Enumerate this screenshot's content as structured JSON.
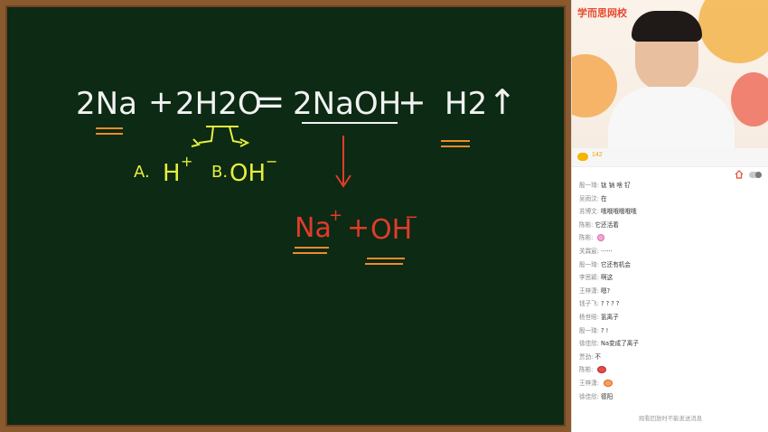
{
  "board": {
    "equation": {
      "reactant_na": "2Na",
      "plus1": "+",
      "reactant_water": "2H2O",
      "equals": "=",
      "product_naoh": "2NaOH",
      "plus2": "+",
      "product_h2": "H2",
      "arrow_up": "↑"
    },
    "options": {
      "a_label": "A.",
      "a_value": "H",
      "a_charge": "+",
      "b_label": "B.",
      "b_value": "OH",
      "b_charge": "−"
    },
    "ions": {
      "na": "Na",
      "na_charge": "+",
      "plus": "+",
      "oh": "OH",
      "oh_charge": "−"
    },
    "colors": {
      "chalk_white": "#f2f2f2",
      "chalk_yellow": "#e8ef3a",
      "chalk_red": "#e23b2a",
      "chalk_orange": "#ef8a2c"
    }
  },
  "video": {
    "logo": "学而思网校"
  },
  "info": {
    "viewer_count": "142"
  },
  "chat": {
    "messages": [
      {
        "who": "殷一琦:",
        "text": "钛 钠 啥 钌"
      },
      {
        "who": "吴雨汶:",
        "text": "在"
      },
      {
        "who": "苏博文:",
        "text": "哦哦哦哦哦哦"
      },
      {
        "who": "陈彬:",
        "text": "它还活着"
      },
      {
        "who": "陈彬:",
        "text": "",
        "sticker": "pink"
      },
      {
        "who": "关霖宸:",
        "text": "······"
      },
      {
        "who": "殷一琦:",
        "text": "它还有机会"
      },
      {
        "who": "李思颖:",
        "text": "啊这"
      },
      {
        "who": "王梓潇:",
        "text": "嗯?"
      },
      {
        "who": "钱子飞:",
        "text": "? ? ? ?"
      },
      {
        "who": "杨世晗:",
        "text": "氢离子"
      },
      {
        "who": "殷一琦:",
        "text": "? !"
      },
      {
        "who": "徐佳欣:",
        "text": "Na变成了离子"
      },
      {
        "who": "贾劲:",
        "text": "不"
      },
      {
        "who": "陈彬:",
        "text": "",
        "sticker": "red"
      },
      {
        "who": "王梓潇:",
        "text": "",
        "sticker": "orange"
      },
      {
        "who": "徐佳欣:",
        "text": "德阳"
      }
    ],
    "notice": "观看回放时不能发送消息"
  }
}
